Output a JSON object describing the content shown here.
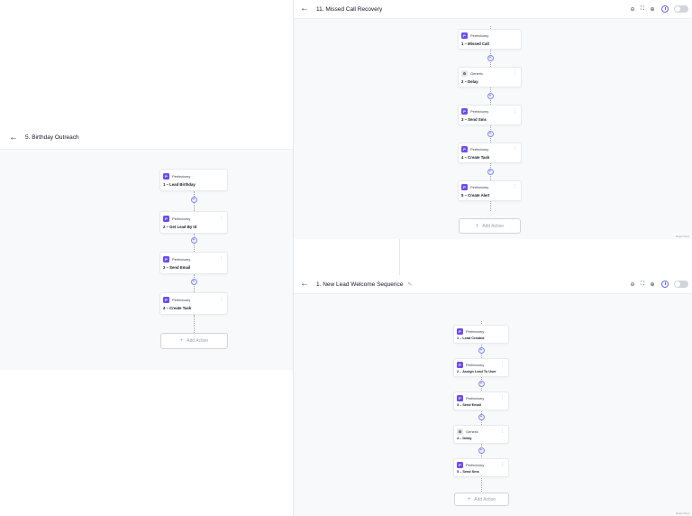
{
  "panels": {
    "birthday": {
      "title": "5. Birthday Outreach",
      "nodes": [
        {
          "app": "Perfectomy",
          "step": "1 – Lead Birthday"
        },
        {
          "app": "Perfectomy",
          "step": "2 – Get Lead By Id"
        },
        {
          "app": "Perfectomy",
          "step": "3 – Send Email"
        },
        {
          "app": "Perfectomy",
          "step": "4 – Create Task"
        }
      ],
      "add_action": "Add Action"
    },
    "missed": {
      "title": "11. Missed Call Recovery",
      "nodes": [
        {
          "app": "Perfectomy",
          "step": "1 – Missed Call"
        },
        {
          "app": "Generic",
          "step": "2 – Delay"
        },
        {
          "app": "Perfectomy",
          "step": "3 – Send Sms"
        },
        {
          "app": "Perfectomy",
          "step": "4 – Create Task"
        },
        {
          "app": "Perfectomy",
          "step": "5 – Create Alert"
        }
      ],
      "add_action": "Add Action",
      "watermark": "React Flow"
    },
    "welcome": {
      "title": "1. New Lead Welcome Sequence",
      "nodes": [
        {
          "app": "Perfectomy",
          "step": "1 – Lead Created"
        },
        {
          "app": "Perfectomy",
          "step": "2 – Assign Lead To User"
        },
        {
          "app": "Perfectomy",
          "step": "3 – Send Email"
        },
        {
          "app": "Generic",
          "step": "4 – Delay"
        },
        {
          "app": "Perfectomy",
          "step": "5 – Send Sms"
        }
      ],
      "add_action": "Add Action",
      "watermark": "React Flow"
    }
  },
  "icons": {
    "back": "arrow-left-icon",
    "zoom_out": "zoom-out-icon",
    "fit": "fit-view-icon",
    "zoom_in": "zoom-in-icon",
    "history": "history-icon",
    "toggle": "active-toggle",
    "app_perfectomy": "perfectomy-logo-icon",
    "app_generic": "generic-app-icon",
    "menu": "more-vertical-icon",
    "plus": "plus-icon"
  },
  "colors": {
    "accent": "#6d4cf0",
    "plus_border": "#818cf8",
    "canvas": "#f8f9fb"
  }
}
